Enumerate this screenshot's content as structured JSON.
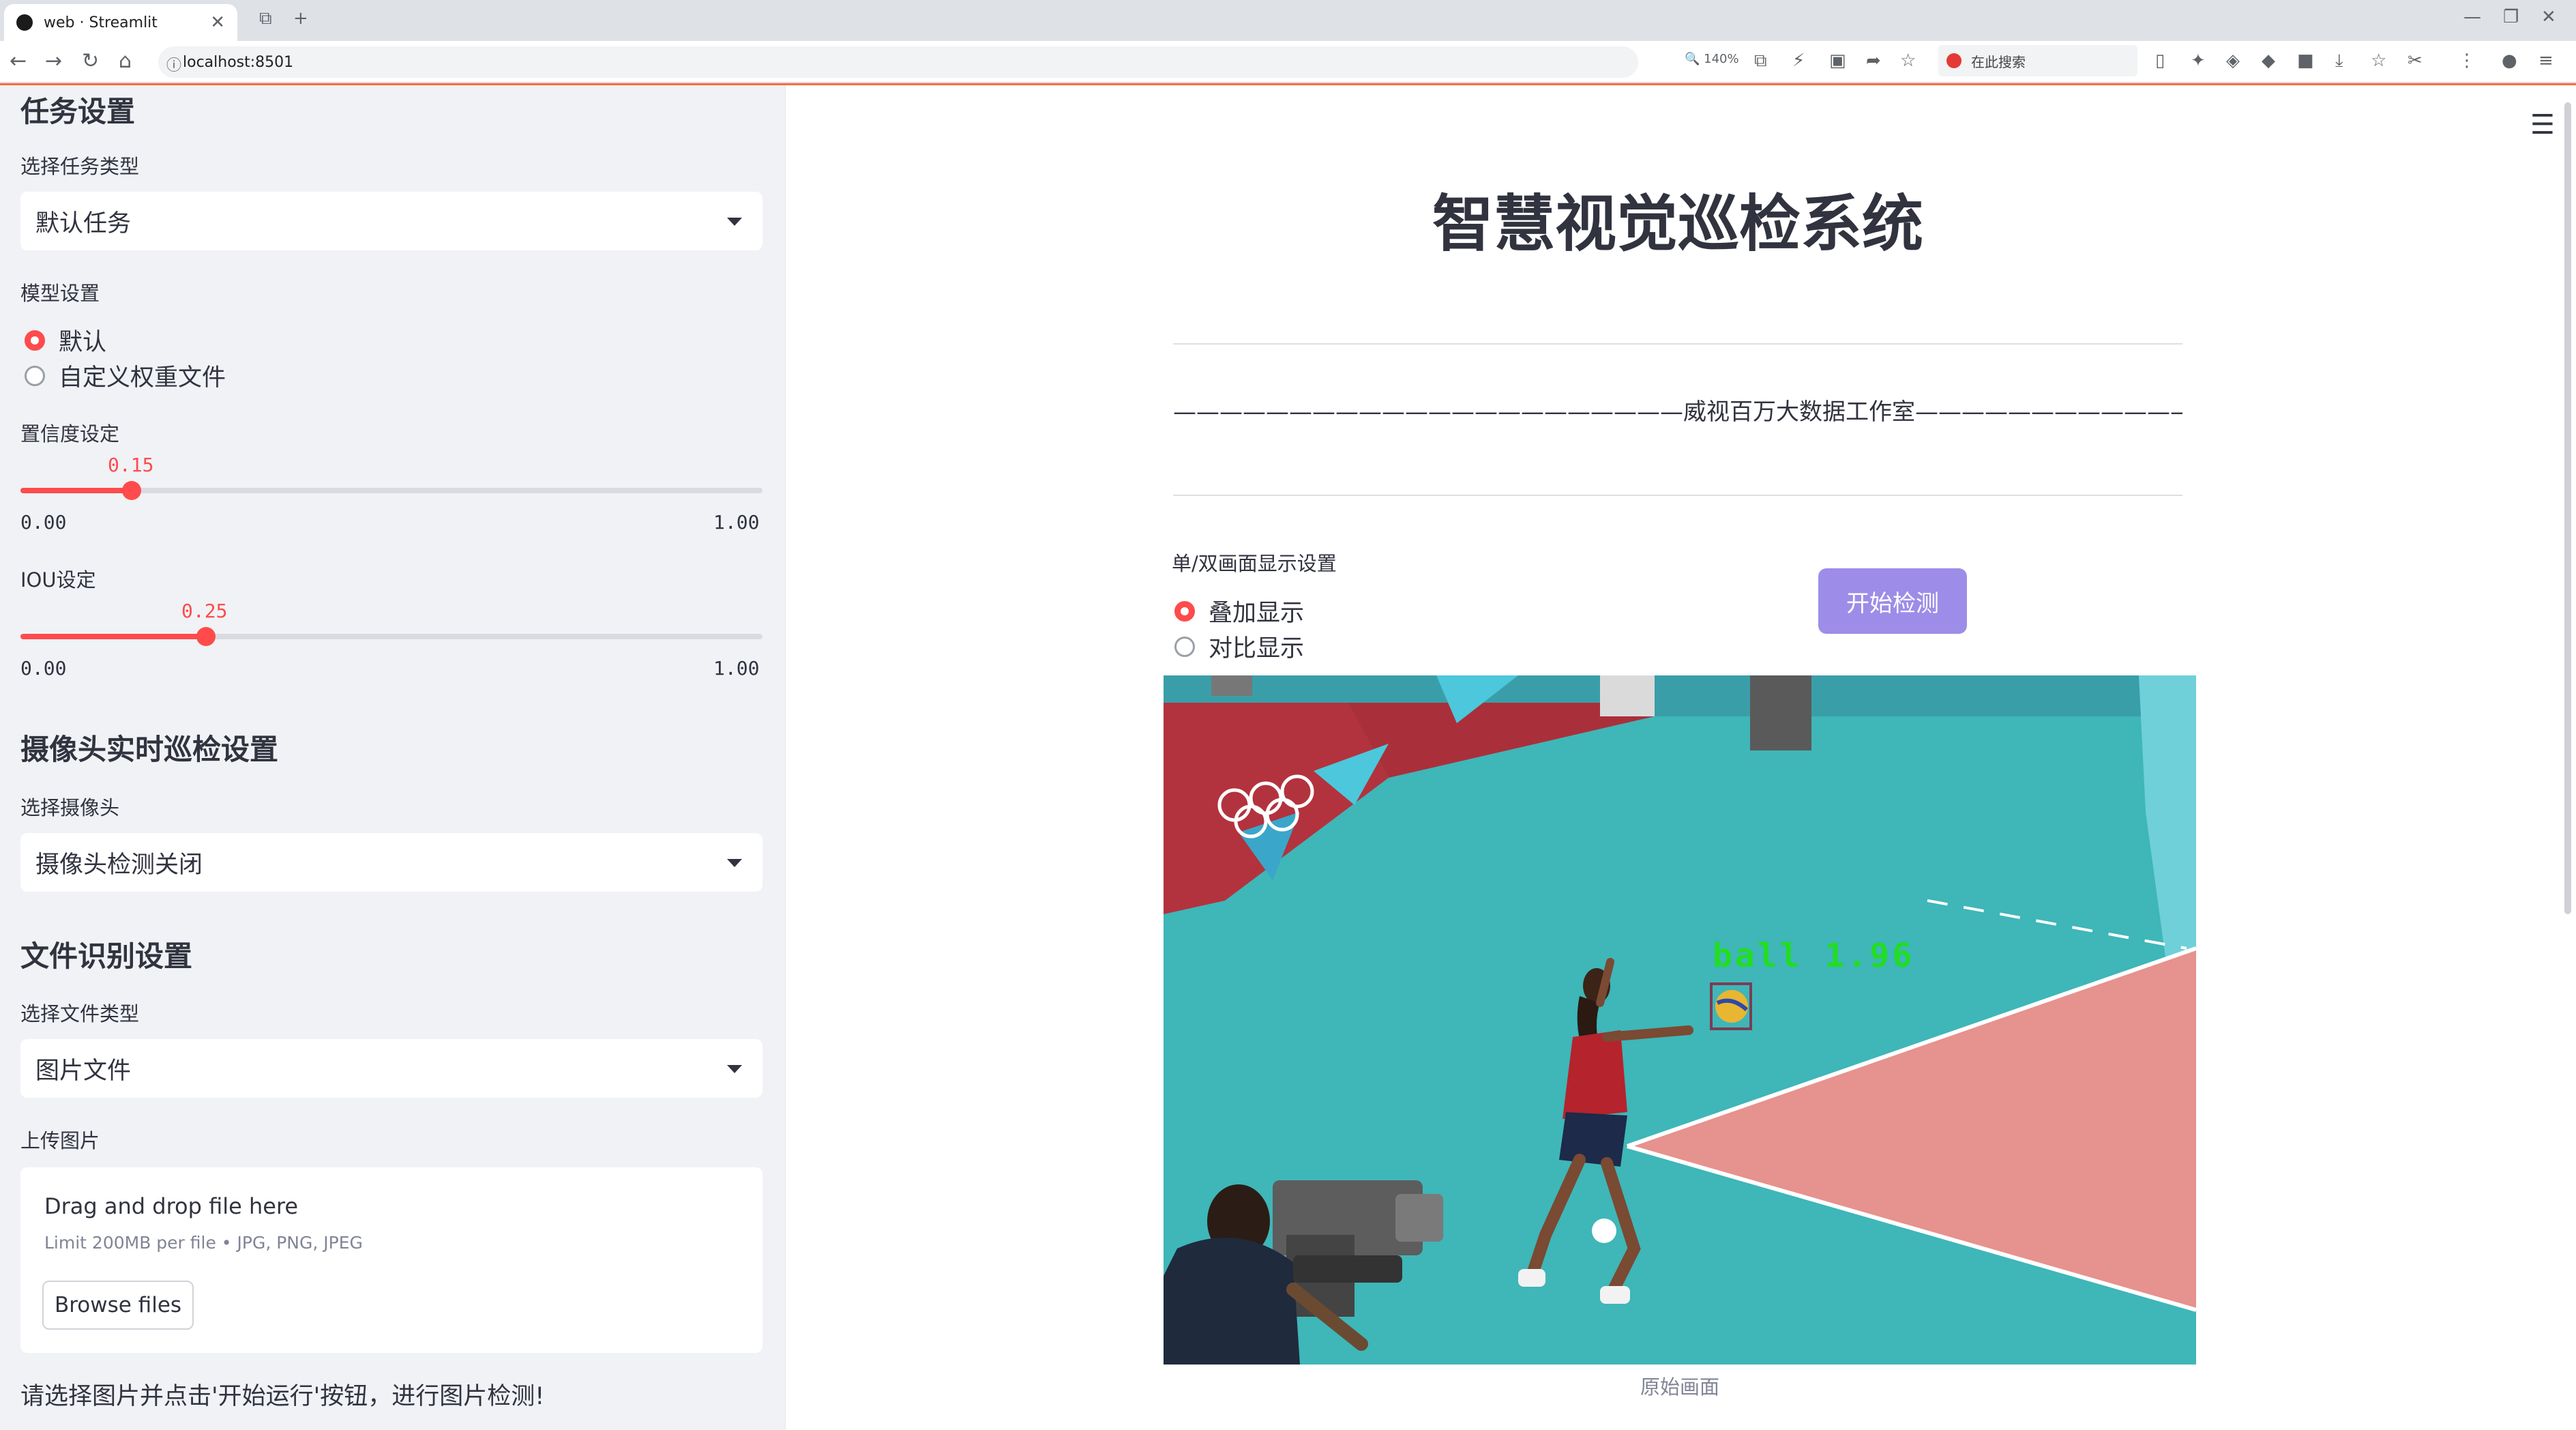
{
  "browser": {
    "tab_title": "web · Streamlit",
    "url": "localhost:8501",
    "zoom": "140%",
    "search_placeholder": "在此搜索"
  },
  "sidebar": {
    "task_header": "任务设置",
    "task_type_label": "选择任务类型",
    "task_type_value": "默认任务",
    "model_label": "模型设置",
    "model_options": [
      "默认",
      "自定义权重文件"
    ],
    "model_selected": 0,
    "conf_label": "置信度设定",
    "conf_value": "0.15",
    "conf_fraction": 0.15,
    "conf_min": "0.00",
    "conf_max": "1.00",
    "iou_label": "IOU设定",
    "iou_value": "0.25",
    "iou_fraction": 0.25,
    "iou_min": "0.00",
    "iou_max": "1.00",
    "camera_header": "摄像头实时巡检设置",
    "camera_label": "选择摄像头",
    "camera_value": "摄像头检测关闭",
    "file_header": "文件识别设置",
    "file_type_label": "选择文件类型",
    "file_type_value": "图片文件",
    "upload_label": "上传图片",
    "drag_text": "Drag and drop file here",
    "limit_text": "Limit 200MB per file • JPG, PNG, JPEG",
    "browse_label": "Browse files",
    "hint": "请选择图片并点击'开始运行'按钮，进行图片检测!"
  },
  "main": {
    "title": "智慧视觉巡检系统",
    "tagline": "——————————————————————威视百万大数据工作室——————————————————————",
    "display_label": "单/双画面显示设置",
    "display_options": [
      "叠加显示",
      "对比显示"
    ],
    "display_selected": 0,
    "start_button": "开始检测",
    "detection_label": "ball 1.96",
    "image_caption": "原始画面"
  },
  "colors": {
    "accent": "#ff4b4b",
    "button": "#9d8de8",
    "detection": "#22dd22"
  }
}
